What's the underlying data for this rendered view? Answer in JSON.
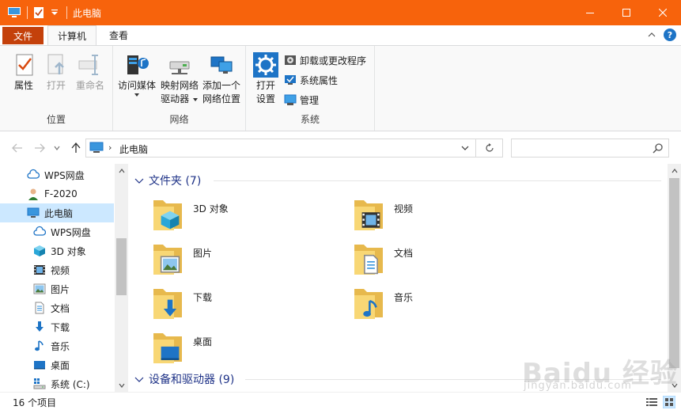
{
  "window": {
    "title": "此电脑",
    "accent": "#f7630c",
    "buttons": [
      "minimize-icon",
      "maximize-icon",
      "close-icon"
    ]
  },
  "ribbon_tabs": {
    "file": "文件",
    "computer": "计算机",
    "view": "查看"
  },
  "ribbon": {
    "groups": {
      "location": "位置",
      "network": "网络",
      "system": "系统"
    },
    "location": {
      "properties": "属性",
      "open": "打开",
      "rename": "重命名"
    },
    "network": {
      "access_media": "访问媒体",
      "map_drive_l1": "映射网络",
      "map_drive_l2": "驱动器",
      "add_location_l1": "添加一个",
      "add_location_l2": "网络位置"
    },
    "system": {
      "open_settings_l1": "打开",
      "open_settings_l2": "设置",
      "uninstall": "卸载或更改程序",
      "sys_props": "系统属性",
      "manage": "管理"
    }
  },
  "address": {
    "crumb": "此电脑",
    "search_placeholder": ""
  },
  "nav_pane": {
    "items": [
      {
        "label": "WPS网盘",
        "icon": "cloud-icon",
        "indent": 0
      },
      {
        "label": "F-2020",
        "icon": "user-icon",
        "indent": 0
      },
      {
        "label": "此电脑",
        "icon": "computer-icon",
        "indent": 0,
        "selected": true
      },
      {
        "label": "WPS网盘",
        "icon": "cloud-icon",
        "indent": 1
      },
      {
        "label": "3D 对象",
        "icon": "cube-icon",
        "indent": 1
      },
      {
        "label": "视频",
        "icon": "video-icon",
        "indent": 1
      },
      {
        "label": "图片",
        "icon": "picture-icon",
        "indent": 1
      },
      {
        "label": "文档",
        "icon": "document-icon",
        "indent": 1
      },
      {
        "label": "下载",
        "icon": "download-icon",
        "indent": 1
      },
      {
        "label": "音乐",
        "icon": "music-icon",
        "indent": 1
      },
      {
        "label": "桌面",
        "icon": "desktop-icon",
        "indent": 1
      },
      {
        "label": "系统 (C:)",
        "icon": "drive-icon",
        "indent": 1
      }
    ]
  },
  "content": {
    "folders_header": "文件夹 (7)",
    "devices_header": "设备和驱动器 (9)",
    "folders": [
      {
        "label": "3D 对象",
        "icon": "cube-icon"
      },
      {
        "label": "视频",
        "icon": "video-icon"
      },
      {
        "label": "图片",
        "icon": "picture-icon"
      },
      {
        "label": "文档",
        "icon": "document-icon"
      },
      {
        "label": "下载",
        "icon": "download-icon"
      },
      {
        "label": "音乐",
        "icon": "music-icon"
      },
      {
        "label": "桌面",
        "icon": "desktop-icon"
      }
    ]
  },
  "status": {
    "count": "16 个项目"
  },
  "watermark": {
    "text": "Baidu 经验",
    "sub": "jingyan.baidu.com"
  }
}
